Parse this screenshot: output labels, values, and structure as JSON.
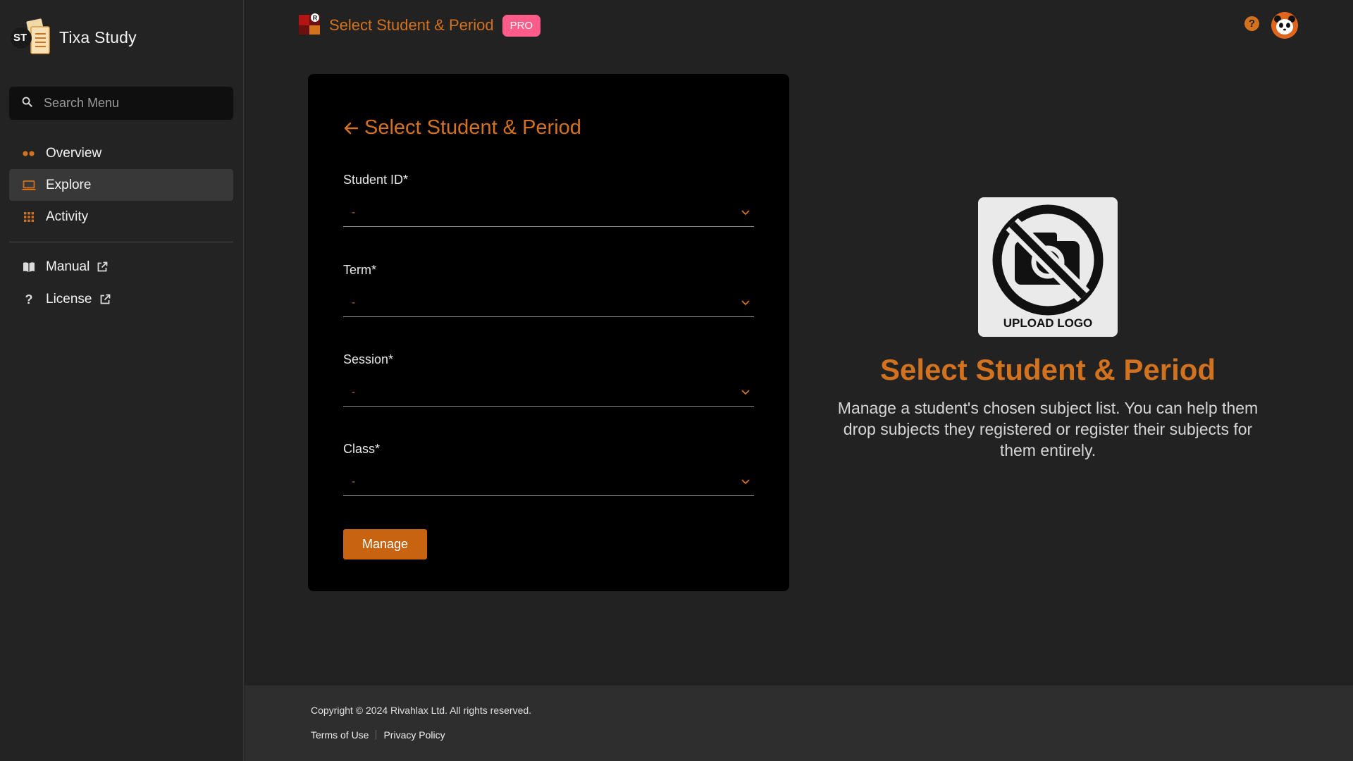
{
  "app": {
    "name": "Tixa Study",
    "logo_initials": "ST"
  },
  "search": {
    "placeholder": "Search Menu"
  },
  "sidebar": {
    "items": [
      {
        "label": "Overview",
        "icon": "dots-icon",
        "active": false
      },
      {
        "label": "Explore",
        "icon": "laptop-icon",
        "active": true
      },
      {
        "label": "Activity",
        "icon": "grid-icon",
        "active": false
      }
    ],
    "links": [
      {
        "label": "Manual",
        "icon": "book-icon",
        "external": true
      },
      {
        "label": "License",
        "icon": "question-icon",
        "external": true
      }
    ]
  },
  "header": {
    "title": "Select Student & Period",
    "badge": "PRO"
  },
  "form": {
    "title": "Select Student & Period",
    "fields": [
      {
        "label": "Student ID*",
        "value": "-"
      },
      {
        "label": "Term*",
        "value": "-"
      },
      {
        "label": "Session*",
        "value": "-"
      },
      {
        "label": "Class*",
        "value": "-"
      }
    ],
    "submit_label": "Manage"
  },
  "info": {
    "logo_caption": "UPLOAD LOGO",
    "title": "Select Student & Period",
    "description": "Manage a student's chosen subject list. You can help them drop subjects they registered or register their subjects for them entirely."
  },
  "footer": {
    "copyright": "Copyright © 2024 Rivahlax Ltd. All rights reserved.",
    "links": [
      "Terms of Use",
      "Privacy Policy"
    ]
  },
  "colors": {
    "accent": "#d2721e",
    "button": "#c8640f",
    "badge": "#ff5c8a",
    "background": "#222222",
    "card": "#000000"
  }
}
